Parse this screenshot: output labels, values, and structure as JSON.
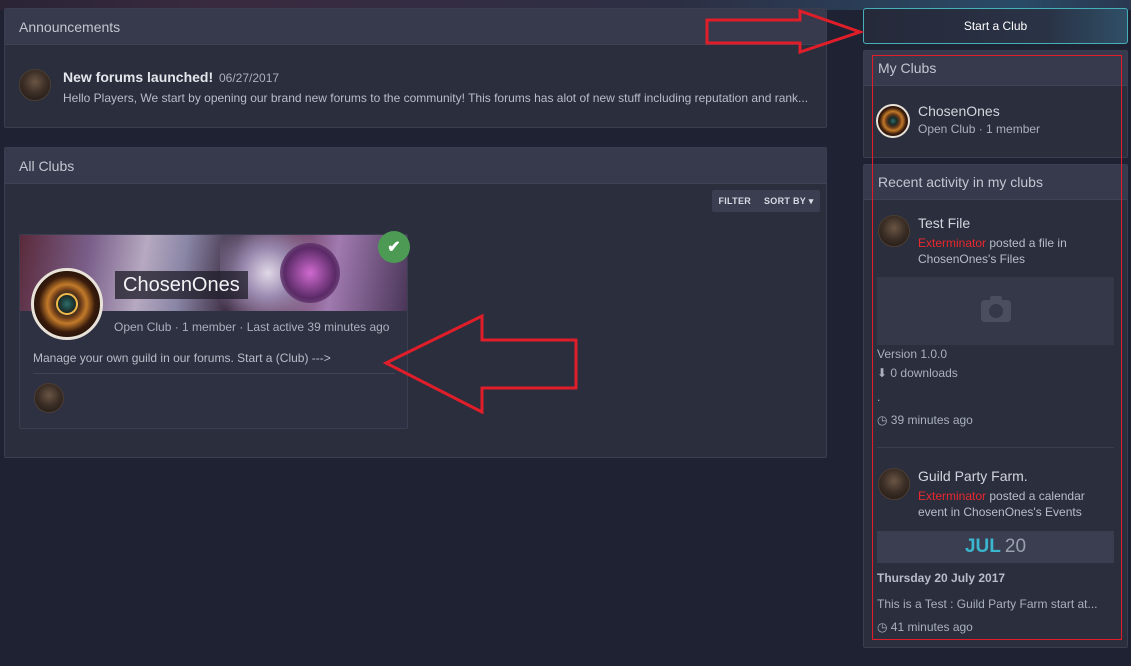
{
  "announcements": {
    "title": "Announcements",
    "item": {
      "title": "New forums launched!",
      "date": "06/27/2017",
      "text": "Hello Players,   We start by opening our brand new forums to the community! This forums has alot of new stuff including reputation and rank..."
    }
  },
  "all_clubs": {
    "title": "All Clubs",
    "filter_label": "FILTER",
    "sort_label": "SORT BY ▾",
    "club": {
      "name": "ChosenOnes",
      "meta": "Open Club  ·  1 member  ·  Last active 39 minutes ago",
      "description": "Manage your own guild in our forums. Start a (Club) --->"
    }
  },
  "sidebar": {
    "start_club_label": "Start a Club",
    "my_clubs": {
      "title": "My Clubs",
      "club_name": "ChosenOnes",
      "club_meta": "Open Club  ·  1 member"
    },
    "recent": {
      "title": "Recent activity in my clubs",
      "activity1": {
        "title": "Test File",
        "user": "Exterminator",
        "action": " posted a file in ChosenOnes's Files",
        "version": "Version 1.0.0",
        "downloads": "⬇ 0 downloads",
        "dot": ".",
        "time": "◷ 39 minutes ago"
      },
      "activity2": {
        "title": "Guild Party Farm.",
        "user": "Exterminator",
        "action": " posted a calendar event in ChosenOnes's Events",
        "month": "JUL",
        "day": "20",
        "full_date": "Thursday 20 July 2017",
        "excerpt": "This is a Test : Guild Party Farm start at...",
        "time": "◷ 41 minutes ago"
      }
    }
  },
  "colors": {
    "accent": "#3bb6cf",
    "user_link": "#e8282e",
    "annotation": "#e01e2a",
    "check_badge": "#4d9a55"
  },
  "icons": {
    "check": "✔",
    "camera": "camera-icon"
  }
}
